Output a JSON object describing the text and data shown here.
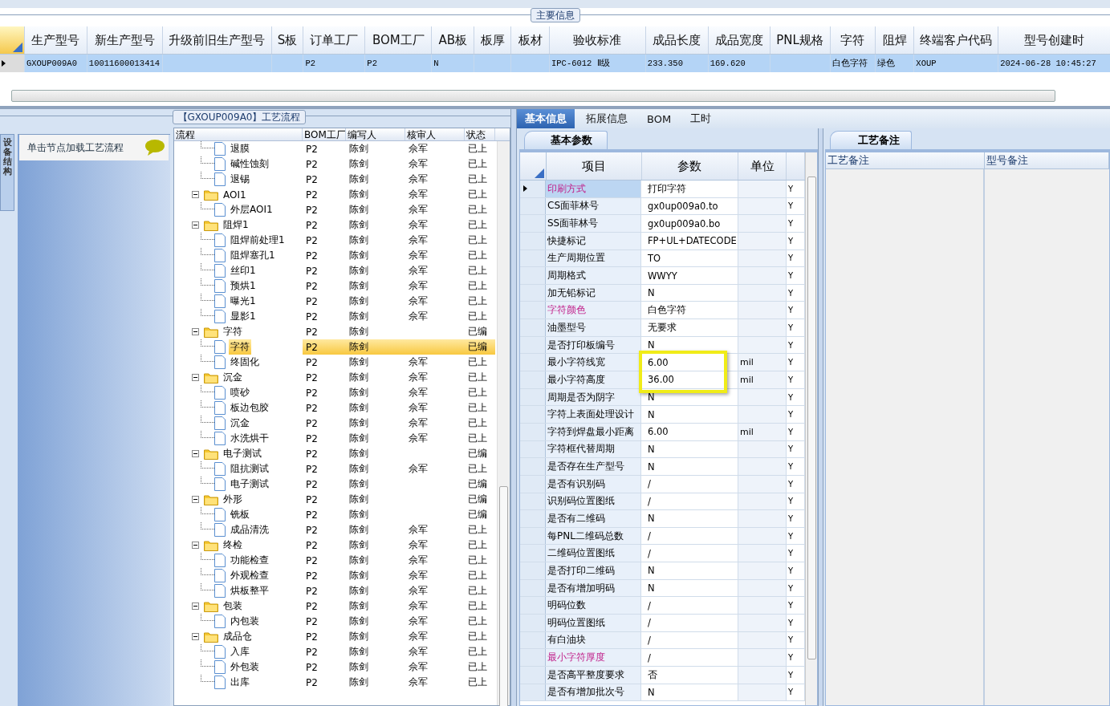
{
  "top_section": {
    "group_label": "主要信息",
    "columns": [
      {
        "header": "生产型号",
        "value": "GXOUP009A0"
      },
      {
        "header": "新生产型号",
        "value": "10011600013414"
      },
      {
        "header": "升级前旧生产型号"
      },
      {
        "header": "S板"
      },
      {
        "header": "订单工厂",
        "value": "P2"
      },
      {
        "header": "BOM工厂",
        "value": "P2"
      },
      {
        "header": "AB板",
        "value": "N"
      },
      {
        "header": "板厚"
      },
      {
        "header": "板材"
      },
      {
        "header": "验收标准",
        "value": "IPC-6012 Ⅱ级"
      },
      {
        "header": "成品长度",
        "value": "233.350"
      },
      {
        "header": "成品宽度",
        "value": "169.620"
      },
      {
        "header": "PNL规格"
      },
      {
        "header": "字符",
        "value": "白色字符"
      },
      {
        "header": "阻焊",
        "value": "绿色"
      },
      {
        "header": "终端客户代码",
        "value": "XOUP"
      },
      {
        "header": "型号创建时",
        "value": "2024-06-28 10:45:27"
      }
    ],
    "row_selected": true
  },
  "side_tab": {
    "label": "设备结构"
  },
  "side_panel": {
    "hint": "单击节点加载工艺流程"
  },
  "process": {
    "group_label": "【GXOUP009A0】工艺流程",
    "columns": [
      "流程",
      "BOM工厂",
      "编写人",
      "核审人",
      "状态"
    ],
    "nodes": [
      {
        "kind": "file",
        "label": "退膜",
        "bom": "P2",
        "writer": "陈剑",
        "reviewer": "佘军",
        "status": "已上",
        "selected": false
      },
      {
        "kind": "file",
        "label": "碱性蚀刻",
        "bom": "P2",
        "writer": "陈剑",
        "reviewer": "佘军",
        "status": "已上",
        "selected": false
      },
      {
        "kind": "file",
        "label": "退锡",
        "bom": "P2",
        "writer": "陈剑",
        "reviewer": "佘军",
        "status": "已上",
        "selected": false
      },
      {
        "kind": "folder",
        "label": "AOI1",
        "bom": "P2",
        "writer": "陈剑",
        "reviewer": "佘军",
        "status": "已上",
        "selected": false,
        "expanded": true,
        "children": [
          {
            "kind": "file",
            "label": "外层AOI1",
            "bom": "P2",
            "writer": "陈剑",
            "reviewer": "佘军",
            "status": "已上",
            "selected": false
          }
        ]
      },
      {
        "kind": "folder",
        "label": "阻焊1",
        "bom": "P2",
        "writer": "陈剑",
        "reviewer": "佘军",
        "status": "已上",
        "selected": false,
        "expanded": true,
        "children": [
          {
            "kind": "file",
            "label": "阻焊前处理1",
            "bom": "P2",
            "writer": "陈剑",
            "reviewer": "佘军",
            "status": "已上",
            "selected": false
          },
          {
            "kind": "file",
            "label": "阻焊塞孔1",
            "bom": "P2",
            "writer": "陈剑",
            "reviewer": "佘军",
            "status": "已上",
            "selected": false
          },
          {
            "kind": "file",
            "label": "丝印1",
            "bom": "P2",
            "writer": "陈剑",
            "reviewer": "佘军",
            "status": "已上",
            "selected": false
          },
          {
            "kind": "file",
            "label": "预烘1",
            "bom": "P2",
            "writer": "陈剑",
            "reviewer": "佘军",
            "status": "已上",
            "selected": false
          },
          {
            "kind": "file",
            "label": "曝光1",
            "bom": "P2",
            "writer": "陈剑",
            "reviewer": "佘军",
            "status": "已上",
            "selected": false
          },
          {
            "kind": "file",
            "label": "显影1",
            "bom": "P2",
            "writer": "陈剑",
            "reviewer": "佘军",
            "status": "已上",
            "selected": false
          }
        ]
      },
      {
        "kind": "folder",
        "label": "字符",
        "bom": "P2",
        "writer": "陈剑",
        "status": "已编",
        "selected": false,
        "expanded": true,
        "children": [
          {
            "kind": "file",
            "label": "字符",
            "bom": "P2",
            "writer": "陈剑",
            "status": "已编",
            "selected": true
          },
          {
            "kind": "file",
            "label": "终固化",
            "bom": "P2",
            "writer": "陈剑",
            "reviewer": "佘军",
            "status": "已上",
            "selected": false
          }
        ]
      },
      {
        "kind": "folder",
        "label": "沉金",
        "bom": "P2",
        "writer": "陈剑",
        "reviewer": "佘军",
        "status": "已上",
        "selected": false,
        "expanded": true,
        "children": [
          {
            "kind": "file",
            "label": "喷砂",
            "bom": "P2",
            "writer": "陈剑",
            "reviewer": "佘军",
            "status": "已上",
            "selected": false
          },
          {
            "kind": "file",
            "label": "板边包胶",
            "bom": "P2",
            "writer": "陈剑",
            "reviewer": "佘军",
            "status": "已上",
            "selected": false
          },
          {
            "kind": "file",
            "label": "沉金",
            "bom": "P2",
            "writer": "陈剑",
            "reviewer": "佘军",
            "status": "已上",
            "selected": false
          },
          {
            "kind": "file",
            "label": "水洗烘干",
            "bom": "P2",
            "writer": "陈剑",
            "reviewer": "佘军",
            "status": "已上",
            "selected": false
          }
        ]
      },
      {
        "kind": "folder",
        "label": "电子测试",
        "bom": "P2",
        "writer": "陈剑",
        "status": "已编",
        "selected": false,
        "expanded": true,
        "children": [
          {
            "kind": "file",
            "label": "阻抗测试",
            "bom": "P2",
            "writer": "陈剑",
            "reviewer": "佘军",
            "status": "已上",
            "selected": false
          },
          {
            "kind": "file",
            "label": "电子测试",
            "bom": "P2",
            "writer": "陈剑",
            "status": "已编",
            "selected": false
          }
        ]
      },
      {
        "kind": "folder",
        "label": "外形",
        "bom": "P2",
        "writer": "陈剑",
        "status": "已编",
        "selected": false,
        "expanded": true,
        "children": [
          {
            "kind": "file",
            "label": "铣板",
            "bom": "P2",
            "writer": "陈剑",
            "status": "已编",
            "selected": false
          },
          {
            "kind": "file",
            "label": "成品清洗",
            "bom": "P2",
            "writer": "陈剑",
            "reviewer": "佘军",
            "status": "已上",
            "selected": false
          }
        ]
      },
      {
        "kind": "folder",
        "label": "终检",
        "bom": "P2",
        "writer": "陈剑",
        "reviewer": "佘军",
        "status": "已上",
        "selected": false,
        "expanded": true,
        "children": [
          {
            "kind": "file",
            "label": "功能检查",
            "bom": "P2",
            "writer": "陈剑",
            "reviewer": "佘军",
            "status": "已上",
            "selected": false
          },
          {
            "kind": "file",
            "label": "外观检查",
            "bom": "P2",
            "writer": "陈剑",
            "reviewer": "佘军",
            "status": "已上",
            "selected": false
          },
          {
            "kind": "file",
            "label": "烘板整平",
            "bom": "P2",
            "writer": "陈剑",
            "reviewer": "佘军",
            "status": "已上",
            "selected": false
          }
        ]
      },
      {
        "kind": "folder",
        "label": "包装",
        "bom": "P2",
        "writer": "陈剑",
        "reviewer": "佘军",
        "status": "已上",
        "selected": false,
        "expanded": true,
        "children": [
          {
            "kind": "file",
            "label": "内包装",
            "bom": "P2",
            "writer": "陈剑",
            "reviewer": "佘军",
            "status": "已上",
            "selected": false
          }
        ]
      },
      {
        "kind": "folder",
        "label": "成品仓",
        "bom": "P2",
        "writer": "陈剑",
        "reviewer": "佘军",
        "status": "已上",
        "selected": false,
        "expanded": true,
        "children": [
          {
            "kind": "file",
            "label": "入库",
            "bom": "P2",
            "writer": "陈剑",
            "reviewer": "佘军",
            "status": "已上",
            "selected": false
          },
          {
            "kind": "file",
            "label": "外包装",
            "bom": "P2",
            "writer": "陈剑",
            "reviewer": "佘军",
            "status": "已上",
            "selected": false
          },
          {
            "kind": "file",
            "label": "出库",
            "bom": "P2",
            "writer": "陈剑",
            "reviewer": "佘军",
            "status": "已上",
            "selected": false
          }
        ]
      }
    ]
  },
  "tabs": [
    {
      "label": "基本信息",
      "selected": true
    },
    {
      "label": "拓展信息",
      "selected": false
    },
    {
      "label": "BOM",
      "selected": false
    },
    {
      "label": "工时",
      "selected": false
    }
  ],
  "params": {
    "tab": "基本参数",
    "columns": [
      "项目",
      "参数",
      "单位"
    ],
    "rows": [
      {
        "item": "印刷方式",
        "value": "打印字符",
        "flag": "Y",
        "highlight": true,
        "current": true,
        "outlined": false
      },
      {
        "item": "CS面菲林号",
        "value": "gx0up009a0.to",
        "flag": "Y",
        "highlight": false,
        "current": false,
        "outlined": false
      },
      {
        "item": "SS面菲林号",
        "value": "gx0up009a0.bo",
        "flag": "Y",
        "highlight": false,
        "current": false,
        "outlined": false
      },
      {
        "item": "快捷标记",
        "value": "FP+UL+DATECODE",
        "flag": "Y",
        "highlight": false,
        "current": false,
        "outlined": false
      },
      {
        "item": "生产周期位置",
        "value": "TO",
        "flag": "Y",
        "highlight": false,
        "current": false,
        "outlined": false
      },
      {
        "item": "周期格式",
        "value": "WWYY",
        "flag": "Y",
        "highlight": false,
        "current": false,
        "outlined": false
      },
      {
        "item": "加无铅标记",
        "value": "N",
        "flag": "Y",
        "highlight": false,
        "current": false,
        "outlined": false
      },
      {
        "item": "字符颜色",
        "value": "白色字符",
        "flag": "Y",
        "highlight": true,
        "current": false,
        "outlined": false
      },
      {
        "item": "油墨型号",
        "value": "无要求",
        "flag": "Y",
        "highlight": false,
        "current": false,
        "outlined": false
      },
      {
        "item": "是否打印板编号",
        "value": "N",
        "flag": "Y",
        "highlight": false,
        "current": false,
        "outlined": false
      },
      {
        "item": "最小字符线宽",
        "value": "6.00",
        "unit": "mil",
        "flag": "Y",
        "highlight": false,
        "current": false,
        "outlined": true
      },
      {
        "item": "最小字符高度",
        "value": "36.00",
        "unit": "mil",
        "flag": "Y",
        "highlight": false,
        "current": false,
        "outlined": true
      },
      {
        "item": "周期是否为阴字",
        "value": "N",
        "flag": "Y",
        "highlight": false,
        "current": false,
        "outlined": false
      },
      {
        "item": "字符上表面处理设计",
        "value": "N",
        "flag": "Y",
        "highlight": false,
        "current": false,
        "outlined": false
      },
      {
        "item": "字符到焊盘最小距离",
        "value": "6.00",
        "unit": "mil",
        "flag": "Y",
        "highlight": false,
        "current": false,
        "outlined": false
      },
      {
        "item": "字符框代替周期",
        "value": "N",
        "flag": "Y",
        "highlight": false,
        "current": false,
        "outlined": false
      },
      {
        "item": "是否存在生产型号",
        "value": "N",
        "flag": "Y",
        "highlight": false,
        "current": false,
        "outlined": false
      },
      {
        "item": "是否有识别码",
        "value": "/",
        "flag": "Y",
        "highlight": false,
        "current": false,
        "outlined": false
      },
      {
        "item": "识别码位置图纸",
        "value": "/",
        "flag": "Y",
        "highlight": false,
        "current": false,
        "outlined": false
      },
      {
        "item": "是否有二维码",
        "value": "N",
        "flag": "Y",
        "highlight": false,
        "current": false,
        "outlined": false
      },
      {
        "item": "每PNL二维码总数",
        "value": "/",
        "flag": "Y",
        "highlight": false,
        "current": false,
        "outlined": false
      },
      {
        "item": "二维码位置图纸",
        "value": "/",
        "flag": "Y",
        "highlight": false,
        "current": false,
        "outlined": false
      },
      {
        "item": "是否打印二维码",
        "value": "N",
        "flag": "Y",
        "highlight": false,
        "current": false,
        "outlined": false
      },
      {
        "item": "是否有增加明码",
        "value": "N",
        "flag": "Y",
        "highlight": false,
        "current": false,
        "outlined": false
      },
      {
        "item": "明码位数",
        "value": "/",
        "flag": "Y",
        "highlight": false,
        "current": false,
        "outlined": false
      },
      {
        "item": "明码位置图纸",
        "value": "/",
        "flag": "Y",
        "highlight": false,
        "current": false,
        "outlined": false
      },
      {
        "item": "有白油块",
        "value": "/",
        "flag": "Y",
        "highlight": false,
        "current": false,
        "outlined": false
      },
      {
        "item": "最小字符厚度",
        "value": "/",
        "flag": "Y",
        "highlight": true,
        "current": false,
        "outlined": false
      },
      {
        "item": "是否高平整度要求",
        "value": "否",
        "flag": "Y",
        "highlight": false,
        "current": false,
        "outlined": false
      },
      {
        "item": "是否有增加批次号",
        "value": "N",
        "flag": "Y",
        "highlight": false,
        "current": false,
        "outlined": false
      }
    ]
  },
  "remarks": {
    "tab": "工艺备注",
    "columns": [
      "工艺备注",
      "型号备注"
    ]
  }
}
